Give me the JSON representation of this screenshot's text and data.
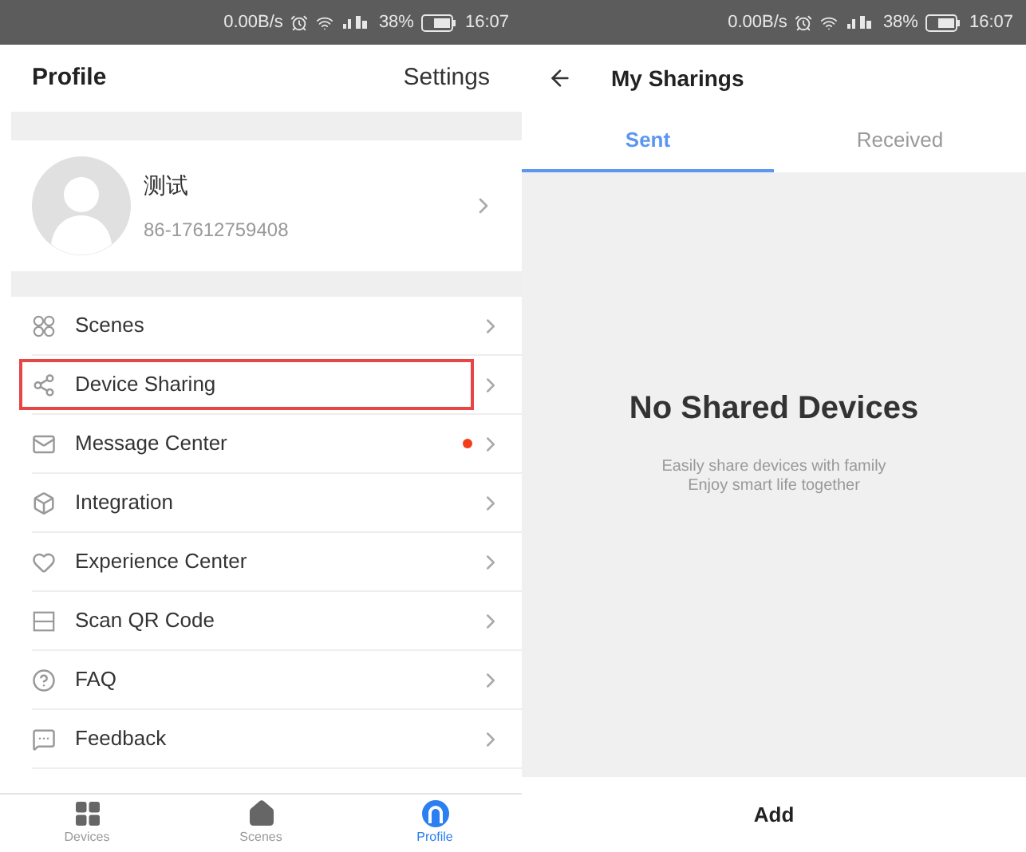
{
  "status_bars": [
    {
      "speed": "0.00B/s",
      "battery": "38%",
      "time": "16:07"
    },
    {
      "speed": "0.00B/s",
      "battery": "38%",
      "time": "16:07"
    }
  ],
  "profile_screen": {
    "title": "Profile",
    "settings": "Settings",
    "user": {
      "name": "测试",
      "phone": "86-17612759408"
    },
    "menu": [
      {
        "label": "Scenes",
        "highlighted": false,
        "unread_dot": false
      },
      {
        "label": "Device Sharing",
        "highlighted": true,
        "unread_dot": false
      },
      {
        "label": "Message Center",
        "highlighted": false,
        "unread_dot": true
      },
      {
        "label": "Integration",
        "highlighted": false,
        "unread_dot": false
      },
      {
        "label": "Experience Center",
        "highlighted": false,
        "unread_dot": false
      },
      {
        "label": "Scan QR Code",
        "highlighted": false,
        "unread_dot": false
      },
      {
        "label": "FAQ",
        "highlighted": false,
        "unread_dot": false
      },
      {
        "label": "Feedback",
        "highlighted": false,
        "unread_dot": false
      }
    ],
    "nav": [
      {
        "label": "Devices",
        "selected": false
      },
      {
        "label": "Scenes",
        "selected": false
      },
      {
        "label": "Profile",
        "selected": true
      }
    ]
  },
  "sharing_screen": {
    "title": "My Sharings",
    "tabs": [
      {
        "label": "Sent",
        "selected": true
      },
      {
        "label": "Received",
        "selected": false
      }
    ],
    "empty_title": "No Shared Devices",
    "empty_lines": [
      "Easily share devices with family",
      "Enjoy smart life together"
    ],
    "add": "Add"
  }
}
